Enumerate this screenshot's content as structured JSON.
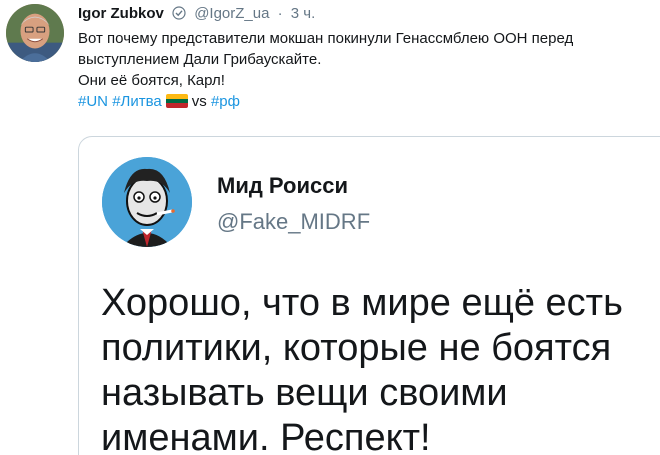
{
  "tweet": {
    "author_name": "Igor Zubkov",
    "handle": "@IgorZ_ua",
    "separator": "·",
    "time": "3 ч.",
    "line1": "Вот почему представители мокшан покинули Генассмблею ООН перед",
    "line2": "выступлением Дали Грибаускайте.",
    "line3": "Они её боятся, Карл!",
    "tag_un": "#UN",
    "tag_lithuania": "#Литва",
    "vs_text": "vs",
    "tag_rf": "#рф",
    "link_color": "#1b95e0"
  },
  "icons": {
    "verified": "verified-badge-icon",
    "flag": "lithuania-flag-icon"
  },
  "flag_colors": [
    "#fdb913",
    "#006a44",
    "#c1272d"
  ],
  "quoted": {
    "name": "Мид Роисси",
    "handle": "@Fake_MIDRF",
    "text": "Хорошо, что в мире ещё есть политики, которые не боятся называть вещи своими именами. Респект!"
  }
}
